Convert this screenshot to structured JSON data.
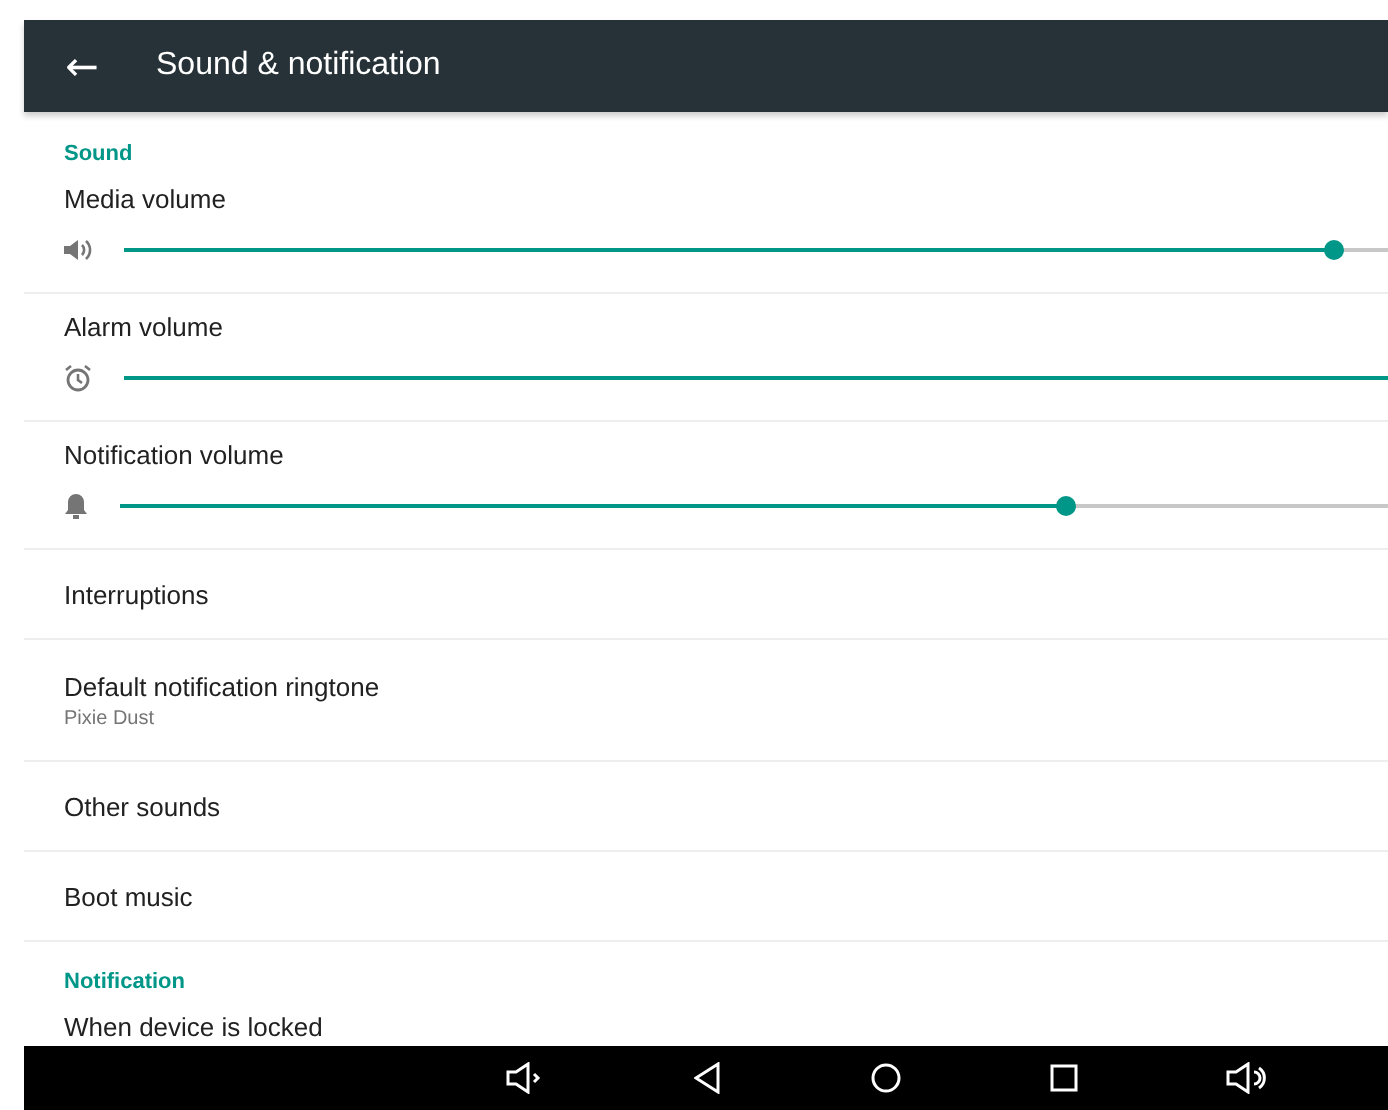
{
  "app_bar": {
    "back": "←",
    "title": "Sound & notification"
  },
  "sections": [
    {
      "header": "Sound",
      "items": [
        {
          "kind": "slider",
          "label": "Media volume",
          "level": 0.957
        },
        {
          "kind": "slider",
          "label": "Alarm volume",
          "level": 1.0
        },
        {
          "kind": "slider",
          "label": "Notification volume",
          "level": 0.746
        },
        {
          "kind": "entry",
          "label": "Interruptions"
        },
        {
          "kind": "entry",
          "label": "Default notification ringtone",
          "summary": "Pixie Dust"
        },
        {
          "kind": "entry",
          "label": "Other sounds"
        },
        {
          "kind": "entry",
          "label": "Boot music"
        }
      ]
    },
    {
      "header": "Notification",
      "items": [
        {
          "kind": "entry",
          "label": "When device is locked"
        }
      ]
    }
  ]
}
